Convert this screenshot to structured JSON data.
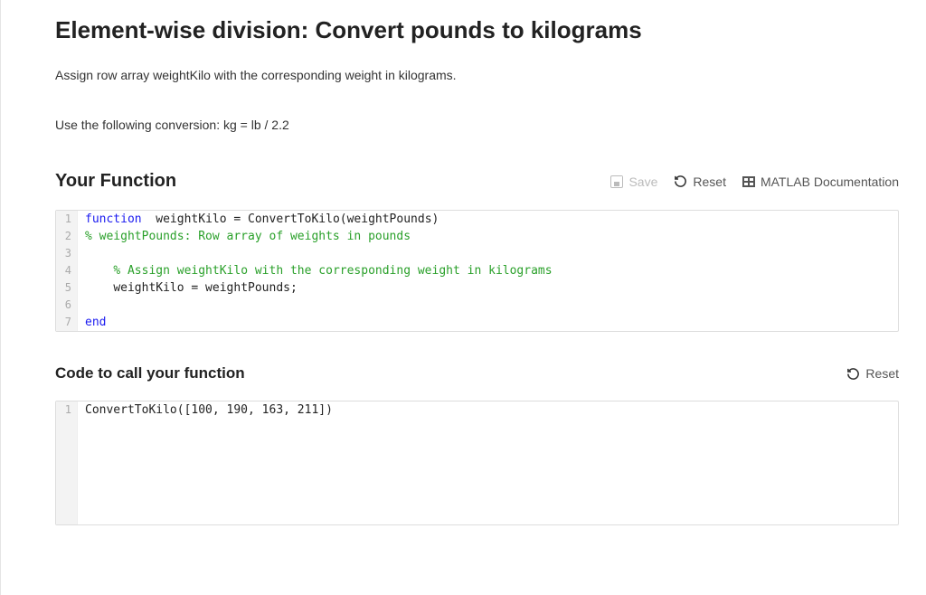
{
  "page": {
    "title": "Element-wise division: Convert pounds to kilograms",
    "instruction1": "Assign row array weightKilo with the corresponding weight in kilograms.",
    "instruction2": "Use the following conversion: kg = lb / 2.2"
  },
  "function_section": {
    "title": "Your Function",
    "toolbar": {
      "save": "Save",
      "reset": "Reset",
      "docs": "MATLAB Documentation"
    },
    "code": {
      "lines": [
        {
          "n": "1",
          "pre_kw": "function",
          "rest": "  weightKilo = ConvertToKilo(weightPounds)"
        },
        {
          "n": "2",
          "comment": "% weightPounds: Row array of weights in pounds"
        },
        {
          "n": "3",
          "blank": ""
        },
        {
          "n": "4",
          "indent": "    ",
          "comment": "% Assign weightKilo with the corresponding weight in kilograms"
        },
        {
          "n": "5",
          "indent": "    ",
          "plain": "weightKilo = weightPounds;"
        },
        {
          "n": "6",
          "blank": ""
        },
        {
          "n": "7",
          "pre_kw": "end",
          "rest": ""
        }
      ]
    }
  },
  "call_section": {
    "title": "Code to call your function",
    "toolbar": {
      "reset": "Reset"
    },
    "code": {
      "lines": [
        {
          "n": "1",
          "plain": "ConvertToKilo([100, 190, 163, 211])"
        }
      ]
    }
  }
}
